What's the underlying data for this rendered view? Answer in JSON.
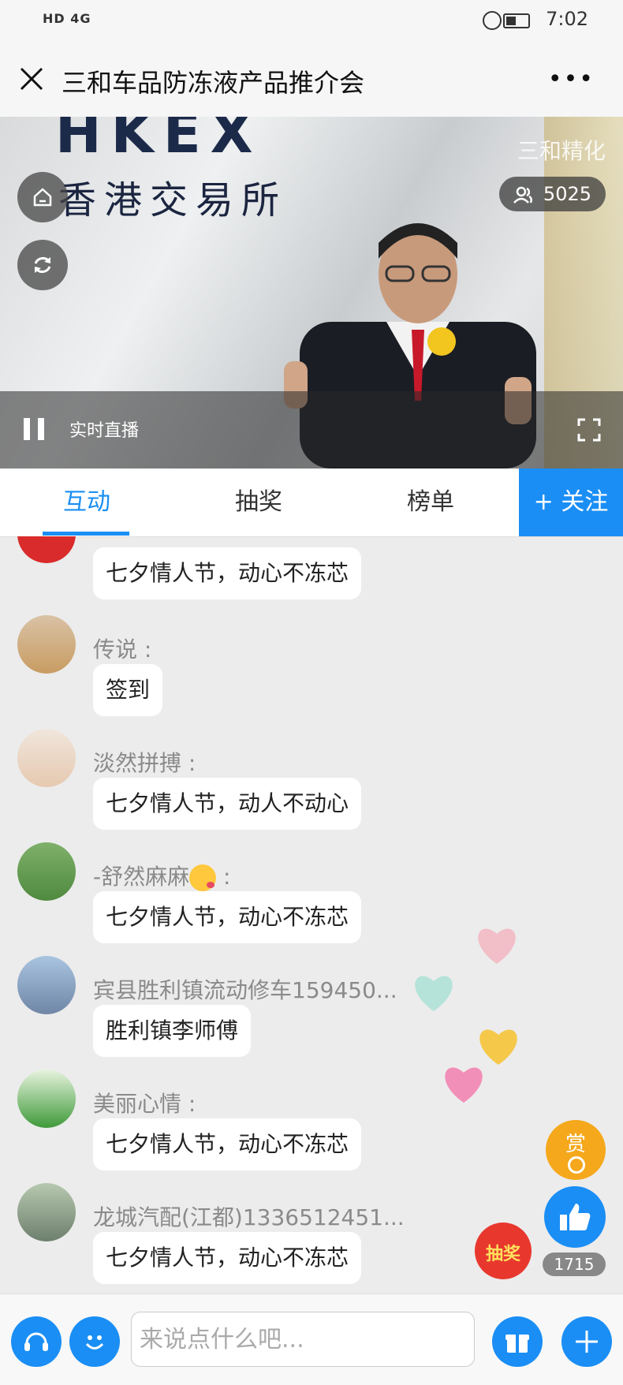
{
  "status_bar": {
    "network": "HD 4G",
    "time": "7:02"
  },
  "header": {
    "title": "三和车品防冻液产品推介会"
  },
  "video": {
    "brand_watermark": "三和精化",
    "viewer_count": "5025",
    "live_label": "实时直播",
    "backdrop_text": "香港交易所",
    "backdrop_logo": "HKEX"
  },
  "tabs": [
    {
      "label": "互动",
      "active": true
    },
    {
      "label": "抽奖",
      "active": false
    },
    {
      "label": "榜单",
      "active": false
    }
  ],
  "follow_label": "+ 关注",
  "messages": [
    {
      "user": "",
      "text": "七夕情人节，动心不冻芯"
    },
    {
      "user": "传说 :",
      "text": "签到"
    },
    {
      "user": "淡然拼搏 :",
      "text": "七夕情人节，动人不动心"
    },
    {
      "user": "-舒然麻麻",
      "user_suffix": " :",
      "text": "七夕情人节，动心不冻芯"
    },
    {
      "user": "宾县胜利镇流动修车159450...",
      "text": "胜利镇李师傅"
    },
    {
      "user": "美丽心情 :",
      "text": "七夕情人节，动心不冻芯"
    },
    {
      "user": "龙城汽配(江都)1336512451...",
      "text": "七夕情人节，动心不冻芯"
    }
  ],
  "reward_label": "赏",
  "lottery_label": "抽奖",
  "like_count": "1715",
  "input_placeholder": "来说点什么吧...",
  "colors": {
    "accent": "#1a8ef5"
  }
}
